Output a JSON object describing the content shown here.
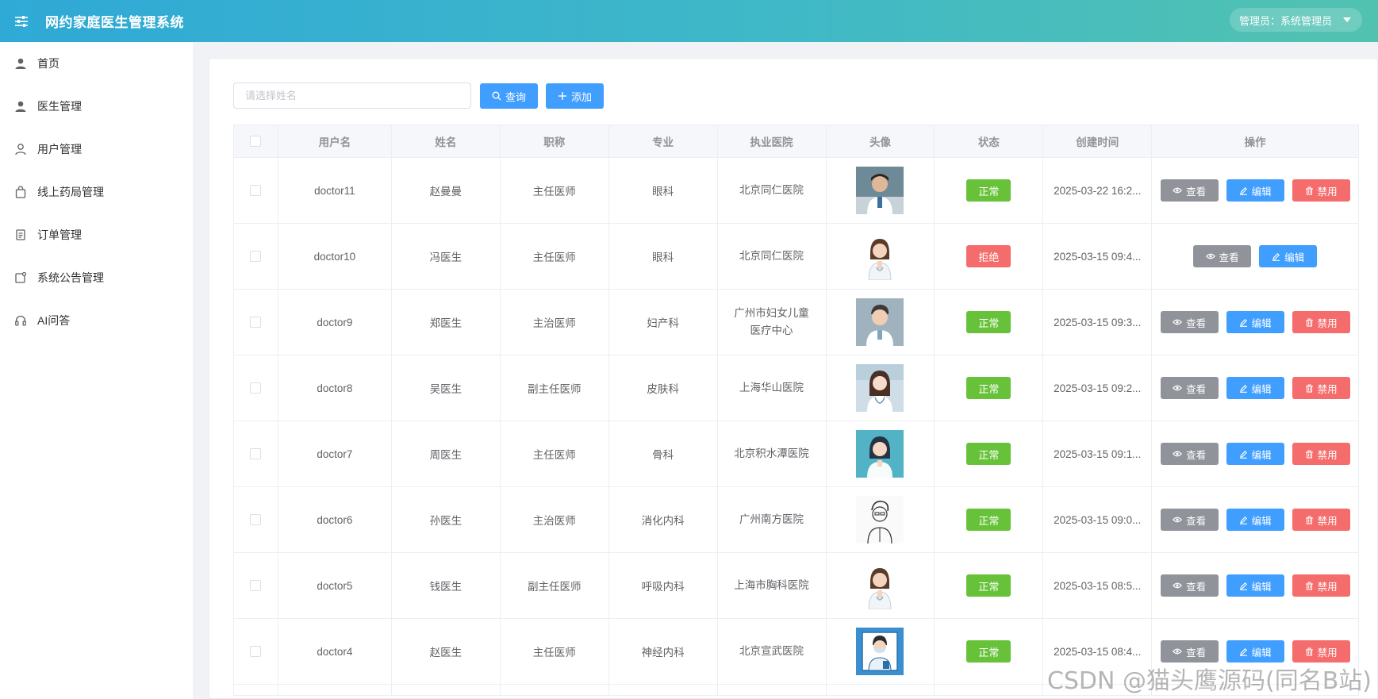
{
  "header": {
    "title": "网约家庭医生管理系统",
    "admin_label": "管理员：系统管理员"
  },
  "sidebar": {
    "items": [
      {
        "label": "首页",
        "icon": "user-icon"
      },
      {
        "label": "医生管理",
        "icon": "user-icon"
      },
      {
        "label": "用户管理",
        "icon": "user-outline-icon"
      },
      {
        "label": "线上药局管理",
        "icon": "bag-icon"
      },
      {
        "label": "订单管理",
        "icon": "document-icon"
      },
      {
        "label": "系统公告管理",
        "icon": "notice-icon"
      },
      {
        "label": "AI问答",
        "icon": "headset-icon"
      }
    ]
  },
  "search": {
    "placeholder": "请选择姓名",
    "query_label": "查询",
    "add_label": "添加"
  },
  "table": {
    "headers": [
      "用户名",
      "姓名",
      "职称",
      "专业",
      "执业医院",
      "头像",
      "状态",
      "创建时间",
      "操作"
    ],
    "rows": [
      {
        "username": "doctor11",
        "name": "赵曼曼",
        "title": "主任医师",
        "major": "眼科",
        "hospital": "北京同仁医院",
        "status": "正常",
        "created": "2025-03-22 16:2...",
        "ops": [
          "查看",
          "编辑",
          "禁用"
        ],
        "avatar": "photo-male"
      },
      {
        "username": "doctor10",
        "name": "冯医生",
        "title": "主任医师",
        "major": "眼科",
        "hospital": "北京同仁医院",
        "status": "拒绝",
        "created": "2025-03-15 09:4...",
        "ops": [
          "查看",
          "编辑"
        ],
        "avatar": "cartoon-female"
      },
      {
        "username": "doctor9",
        "name": "郑医生",
        "title": "主治医师",
        "major": "妇产科",
        "hospital": "广州市妇女儿童医疗中心",
        "status": "正常",
        "created": "2025-03-15 09:3...",
        "ops": [
          "查看",
          "编辑",
          "禁用"
        ],
        "avatar": "cartoon-male"
      },
      {
        "username": "doctor8",
        "name": "吴医生",
        "title": "副主任医师",
        "major": "皮肤科",
        "hospital": "上海华山医院",
        "status": "正常",
        "created": "2025-03-15 09:2...",
        "ops": [
          "查看",
          "编辑",
          "禁用"
        ],
        "avatar": "anime-female"
      },
      {
        "username": "doctor7",
        "name": "周医生",
        "title": "主任医师",
        "major": "骨科",
        "hospital": "北京积水潭医院",
        "status": "正常",
        "created": "2025-03-15 09:1...",
        "ops": [
          "查看",
          "编辑",
          "禁用"
        ],
        "avatar": "teal-female"
      },
      {
        "username": "doctor6",
        "name": "孙医生",
        "title": "主治医师",
        "major": "消化内科",
        "hospital": "广州南方医院",
        "status": "正常",
        "created": "2025-03-15 09:0...",
        "ops": [
          "查看",
          "编辑",
          "禁用"
        ],
        "avatar": "sketch-male"
      },
      {
        "username": "doctor5",
        "name": "钱医生",
        "title": "副主任医师",
        "major": "呼吸内科",
        "hospital": "上海市胸科医院",
        "status": "正常",
        "created": "2025-03-15 08:5...",
        "ops": [
          "查看",
          "编辑",
          "禁用"
        ],
        "avatar": "cartoon-female"
      },
      {
        "username": "doctor4",
        "name": "赵医生",
        "title": "主任医师",
        "major": "神经内科",
        "hospital": "北京宣武医院",
        "status": "正常",
        "created": "2025-03-15 08:4...",
        "ops": [
          "查看",
          "编辑",
          "禁用"
        ],
        "avatar": "blue-doctor"
      }
    ]
  },
  "colors": {
    "primary": "#409eff",
    "success": "#67c23a",
    "danger": "#f56c6c",
    "info": "#909399"
  },
  "watermark": "CSDN @猫头鹰源码(同名B站)"
}
